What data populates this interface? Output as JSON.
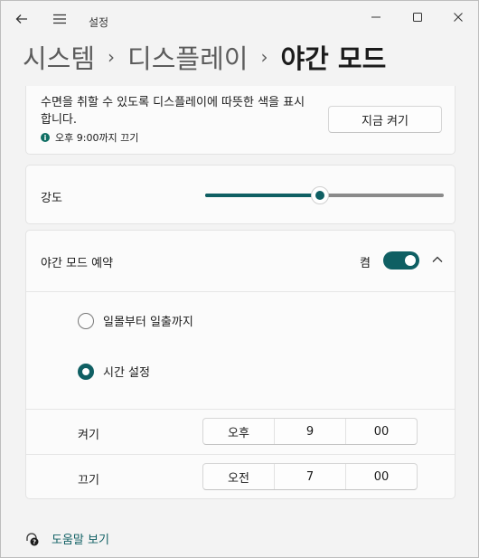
{
  "window": {
    "title": "설정"
  },
  "breadcrumb": {
    "items": [
      "시스템",
      "디스플레이",
      "야간 모드"
    ]
  },
  "night_light": {
    "description": "수면을 취할 수 있도록 디스플레이에 따뜻한 색을 표시합니다.",
    "status_note": "오후 9:00까지 끄기",
    "turn_on_now_label": "지금 켜기"
  },
  "strength": {
    "label": "강도",
    "value_percent": 48
  },
  "schedule": {
    "label": "야간 모드 예약",
    "toggle_state_label": "켬",
    "options": [
      {
        "label": "일몰부터 일출까지",
        "selected": false
      },
      {
        "label": "시간 설정",
        "selected": true
      }
    ],
    "turn_on": {
      "label": "켜기",
      "ampm": "오후",
      "hour": "9",
      "minute": "00"
    },
    "turn_off": {
      "label": "끄기",
      "ampm": "오전",
      "hour": "7",
      "minute": "00"
    }
  },
  "help": {
    "label": "도움말 보기"
  },
  "colors": {
    "accent": "#0f5f63",
    "background": "#f3f3f3",
    "card": "#fbfbfb"
  }
}
